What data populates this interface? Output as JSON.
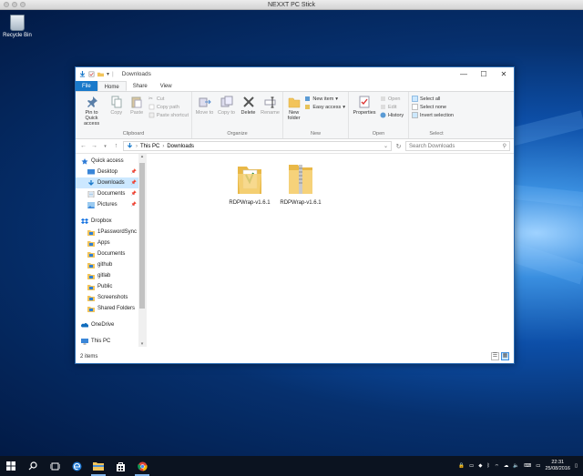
{
  "host_window": {
    "title": "NEXXT PC Stick"
  },
  "desktop": {
    "recycle_bin_label": "Recycle Bin"
  },
  "explorer": {
    "title": "Downloads",
    "window_controls": {
      "minimize": "—",
      "maximize": "☐",
      "close": "✕"
    },
    "tabs": [
      "File",
      "Home",
      "Share",
      "View"
    ],
    "ribbon": {
      "clipboard": {
        "group": "Clipboard",
        "pin": "Pin to Quick access",
        "copy": "Copy",
        "paste": "Paste",
        "cut": "Cut",
        "copy_path": "Copy path",
        "paste_shortcut": "Paste shortcut"
      },
      "organize": {
        "group": "Organize",
        "move_to": "Move to",
        "copy_to": "Copy to",
        "delete": "Delete",
        "rename": "Rename"
      },
      "new": {
        "group": "New",
        "new_folder": "New folder",
        "new_item": "New item",
        "easy_access": "Easy access"
      },
      "open": {
        "group": "Open",
        "properties": "Properties",
        "open": "Open",
        "edit": "Edit",
        "history": "History"
      },
      "select": {
        "group": "Select",
        "select_all": "Select all",
        "select_none": "Select none",
        "invert": "Invert selection"
      }
    },
    "address": {
      "segments": [
        "This PC",
        "Downloads"
      ],
      "search_placeholder": "Search Downloads"
    },
    "nav_pane": [
      {
        "label": "Quick access",
        "icon": "star-icon",
        "sub": false
      },
      {
        "label": "Desktop",
        "icon": "desktop-icon",
        "sub": true,
        "pinned": true
      },
      {
        "label": "Downloads",
        "icon": "download-arrow-icon",
        "sub": true,
        "pinned": true,
        "selected": true
      },
      {
        "label": "Documents",
        "icon": "documents-icon",
        "sub": true,
        "pinned": true
      },
      {
        "label": "Pictures",
        "icon": "pictures-icon",
        "sub": true,
        "pinned": true
      },
      {
        "gap": true
      },
      {
        "label": "Dropbox",
        "icon": "dropbox-icon",
        "sub": false
      },
      {
        "label": "1PasswordSync",
        "icon": "folder-icon",
        "sub": true
      },
      {
        "label": "Apps",
        "icon": "folder-icon",
        "sub": true
      },
      {
        "label": "Documents",
        "icon": "folder-icon",
        "sub": true
      },
      {
        "label": "github",
        "icon": "folder-icon",
        "sub": true
      },
      {
        "label": "gitlab",
        "icon": "folder-icon",
        "sub": true
      },
      {
        "label": "Public",
        "icon": "folder-icon",
        "sub": true
      },
      {
        "label": "Screenshots",
        "icon": "folder-icon",
        "sub": true
      },
      {
        "label": "Shared Folders",
        "icon": "folder-icon",
        "sub": true
      },
      {
        "gap": true
      },
      {
        "label": "OneDrive",
        "icon": "onedrive-icon",
        "sub": false
      },
      {
        "gap": true
      },
      {
        "label": "This PC",
        "icon": "computer-icon",
        "sub": false
      }
    ],
    "files": [
      {
        "name": "RDPWrap-v1.6.1",
        "type": "folder-open"
      },
      {
        "name": "RDPWrap-v1.6.1",
        "type": "zip-folder"
      }
    ],
    "status": {
      "item_count": "2 items"
    },
    "pin_glyph": "📌"
  },
  "taskbar": {
    "time": "22:31",
    "date": "25/08/2016",
    "icons": [
      "start-icon",
      "search-icon",
      "task-view-icon",
      "edge-icon",
      "file-explorer-icon",
      "store-icon",
      "chrome-icon"
    ]
  },
  "colors": {
    "accent": "#1979ca",
    "selection": "#cce8ff",
    "folder": "#f2c45a"
  }
}
